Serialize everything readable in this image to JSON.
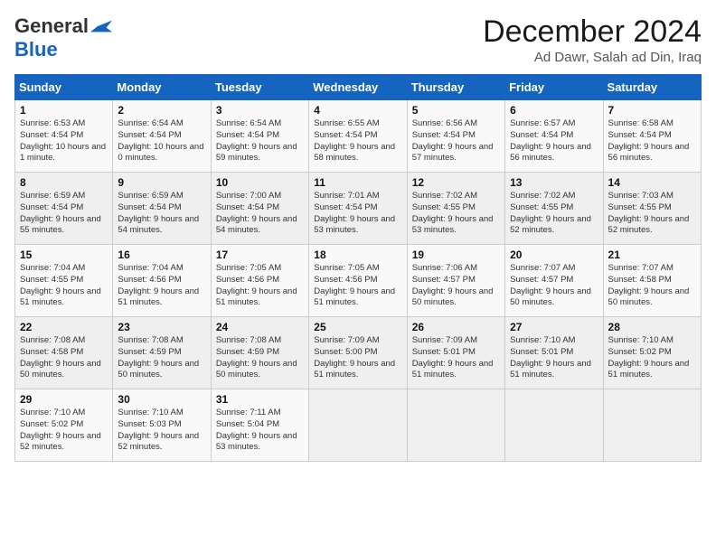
{
  "header": {
    "logo_general": "General",
    "logo_blue": "Blue",
    "month_title": "December 2024",
    "location": "Ad Dawr, Salah ad Din, Iraq"
  },
  "columns": [
    "Sunday",
    "Monday",
    "Tuesday",
    "Wednesday",
    "Thursday",
    "Friday",
    "Saturday"
  ],
  "weeks": [
    [
      {
        "day": "1",
        "sunrise": "Sunrise: 6:53 AM",
        "sunset": "Sunset: 4:54 PM",
        "daylight": "Daylight: 10 hours and 1 minute."
      },
      {
        "day": "2",
        "sunrise": "Sunrise: 6:54 AM",
        "sunset": "Sunset: 4:54 PM",
        "daylight": "Daylight: 10 hours and 0 minutes."
      },
      {
        "day": "3",
        "sunrise": "Sunrise: 6:54 AM",
        "sunset": "Sunset: 4:54 PM",
        "daylight": "Daylight: 9 hours and 59 minutes."
      },
      {
        "day": "4",
        "sunrise": "Sunrise: 6:55 AM",
        "sunset": "Sunset: 4:54 PM",
        "daylight": "Daylight: 9 hours and 58 minutes."
      },
      {
        "day": "5",
        "sunrise": "Sunrise: 6:56 AM",
        "sunset": "Sunset: 4:54 PM",
        "daylight": "Daylight: 9 hours and 57 minutes."
      },
      {
        "day": "6",
        "sunrise": "Sunrise: 6:57 AM",
        "sunset": "Sunset: 4:54 PM",
        "daylight": "Daylight: 9 hours and 56 minutes."
      },
      {
        "day": "7",
        "sunrise": "Sunrise: 6:58 AM",
        "sunset": "Sunset: 4:54 PM",
        "daylight": "Daylight: 9 hours and 56 minutes."
      }
    ],
    [
      {
        "day": "8",
        "sunrise": "Sunrise: 6:59 AM",
        "sunset": "Sunset: 4:54 PM",
        "daylight": "Daylight: 9 hours and 55 minutes."
      },
      {
        "day": "9",
        "sunrise": "Sunrise: 6:59 AM",
        "sunset": "Sunset: 4:54 PM",
        "daylight": "Daylight: 9 hours and 54 minutes."
      },
      {
        "day": "10",
        "sunrise": "Sunrise: 7:00 AM",
        "sunset": "Sunset: 4:54 PM",
        "daylight": "Daylight: 9 hours and 54 minutes."
      },
      {
        "day": "11",
        "sunrise": "Sunrise: 7:01 AM",
        "sunset": "Sunset: 4:54 PM",
        "daylight": "Daylight: 9 hours and 53 minutes."
      },
      {
        "day": "12",
        "sunrise": "Sunrise: 7:02 AM",
        "sunset": "Sunset: 4:55 PM",
        "daylight": "Daylight: 9 hours and 53 minutes."
      },
      {
        "day": "13",
        "sunrise": "Sunrise: 7:02 AM",
        "sunset": "Sunset: 4:55 PM",
        "daylight": "Daylight: 9 hours and 52 minutes."
      },
      {
        "day": "14",
        "sunrise": "Sunrise: 7:03 AM",
        "sunset": "Sunset: 4:55 PM",
        "daylight": "Daylight: 9 hours and 52 minutes."
      }
    ],
    [
      {
        "day": "15",
        "sunrise": "Sunrise: 7:04 AM",
        "sunset": "Sunset: 4:55 PM",
        "daylight": "Daylight: 9 hours and 51 minutes."
      },
      {
        "day": "16",
        "sunrise": "Sunrise: 7:04 AM",
        "sunset": "Sunset: 4:56 PM",
        "daylight": "Daylight: 9 hours and 51 minutes."
      },
      {
        "day": "17",
        "sunrise": "Sunrise: 7:05 AM",
        "sunset": "Sunset: 4:56 PM",
        "daylight": "Daylight: 9 hours and 51 minutes."
      },
      {
        "day": "18",
        "sunrise": "Sunrise: 7:05 AM",
        "sunset": "Sunset: 4:56 PM",
        "daylight": "Daylight: 9 hours and 51 minutes."
      },
      {
        "day": "19",
        "sunrise": "Sunrise: 7:06 AM",
        "sunset": "Sunset: 4:57 PM",
        "daylight": "Daylight: 9 hours and 50 minutes."
      },
      {
        "day": "20",
        "sunrise": "Sunrise: 7:07 AM",
        "sunset": "Sunset: 4:57 PM",
        "daylight": "Daylight: 9 hours and 50 minutes."
      },
      {
        "day": "21",
        "sunrise": "Sunrise: 7:07 AM",
        "sunset": "Sunset: 4:58 PM",
        "daylight": "Daylight: 9 hours and 50 minutes."
      }
    ],
    [
      {
        "day": "22",
        "sunrise": "Sunrise: 7:08 AM",
        "sunset": "Sunset: 4:58 PM",
        "daylight": "Daylight: 9 hours and 50 minutes."
      },
      {
        "day": "23",
        "sunrise": "Sunrise: 7:08 AM",
        "sunset": "Sunset: 4:59 PM",
        "daylight": "Daylight: 9 hours and 50 minutes."
      },
      {
        "day": "24",
        "sunrise": "Sunrise: 7:08 AM",
        "sunset": "Sunset: 4:59 PM",
        "daylight": "Daylight: 9 hours and 50 minutes."
      },
      {
        "day": "25",
        "sunrise": "Sunrise: 7:09 AM",
        "sunset": "Sunset: 5:00 PM",
        "daylight": "Daylight: 9 hours and 51 minutes."
      },
      {
        "day": "26",
        "sunrise": "Sunrise: 7:09 AM",
        "sunset": "Sunset: 5:01 PM",
        "daylight": "Daylight: 9 hours and 51 minutes."
      },
      {
        "day": "27",
        "sunrise": "Sunrise: 7:10 AM",
        "sunset": "Sunset: 5:01 PM",
        "daylight": "Daylight: 9 hours and 51 minutes."
      },
      {
        "day": "28",
        "sunrise": "Sunrise: 7:10 AM",
        "sunset": "Sunset: 5:02 PM",
        "daylight": "Daylight: 9 hours and 51 minutes."
      }
    ],
    [
      {
        "day": "29",
        "sunrise": "Sunrise: 7:10 AM",
        "sunset": "Sunset: 5:02 PM",
        "daylight": "Daylight: 9 hours and 52 minutes."
      },
      {
        "day": "30",
        "sunrise": "Sunrise: 7:10 AM",
        "sunset": "Sunset: 5:03 PM",
        "daylight": "Daylight: 9 hours and 52 minutes."
      },
      {
        "day": "31",
        "sunrise": "Sunrise: 7:11 AM",
        "sunset": "Sunset: 5:04 PM",
        "daylight": "Daylight: 9 hours and 53 minutes."
      },
      null,
      null,
      null,
      null
    ]
  ]
}
